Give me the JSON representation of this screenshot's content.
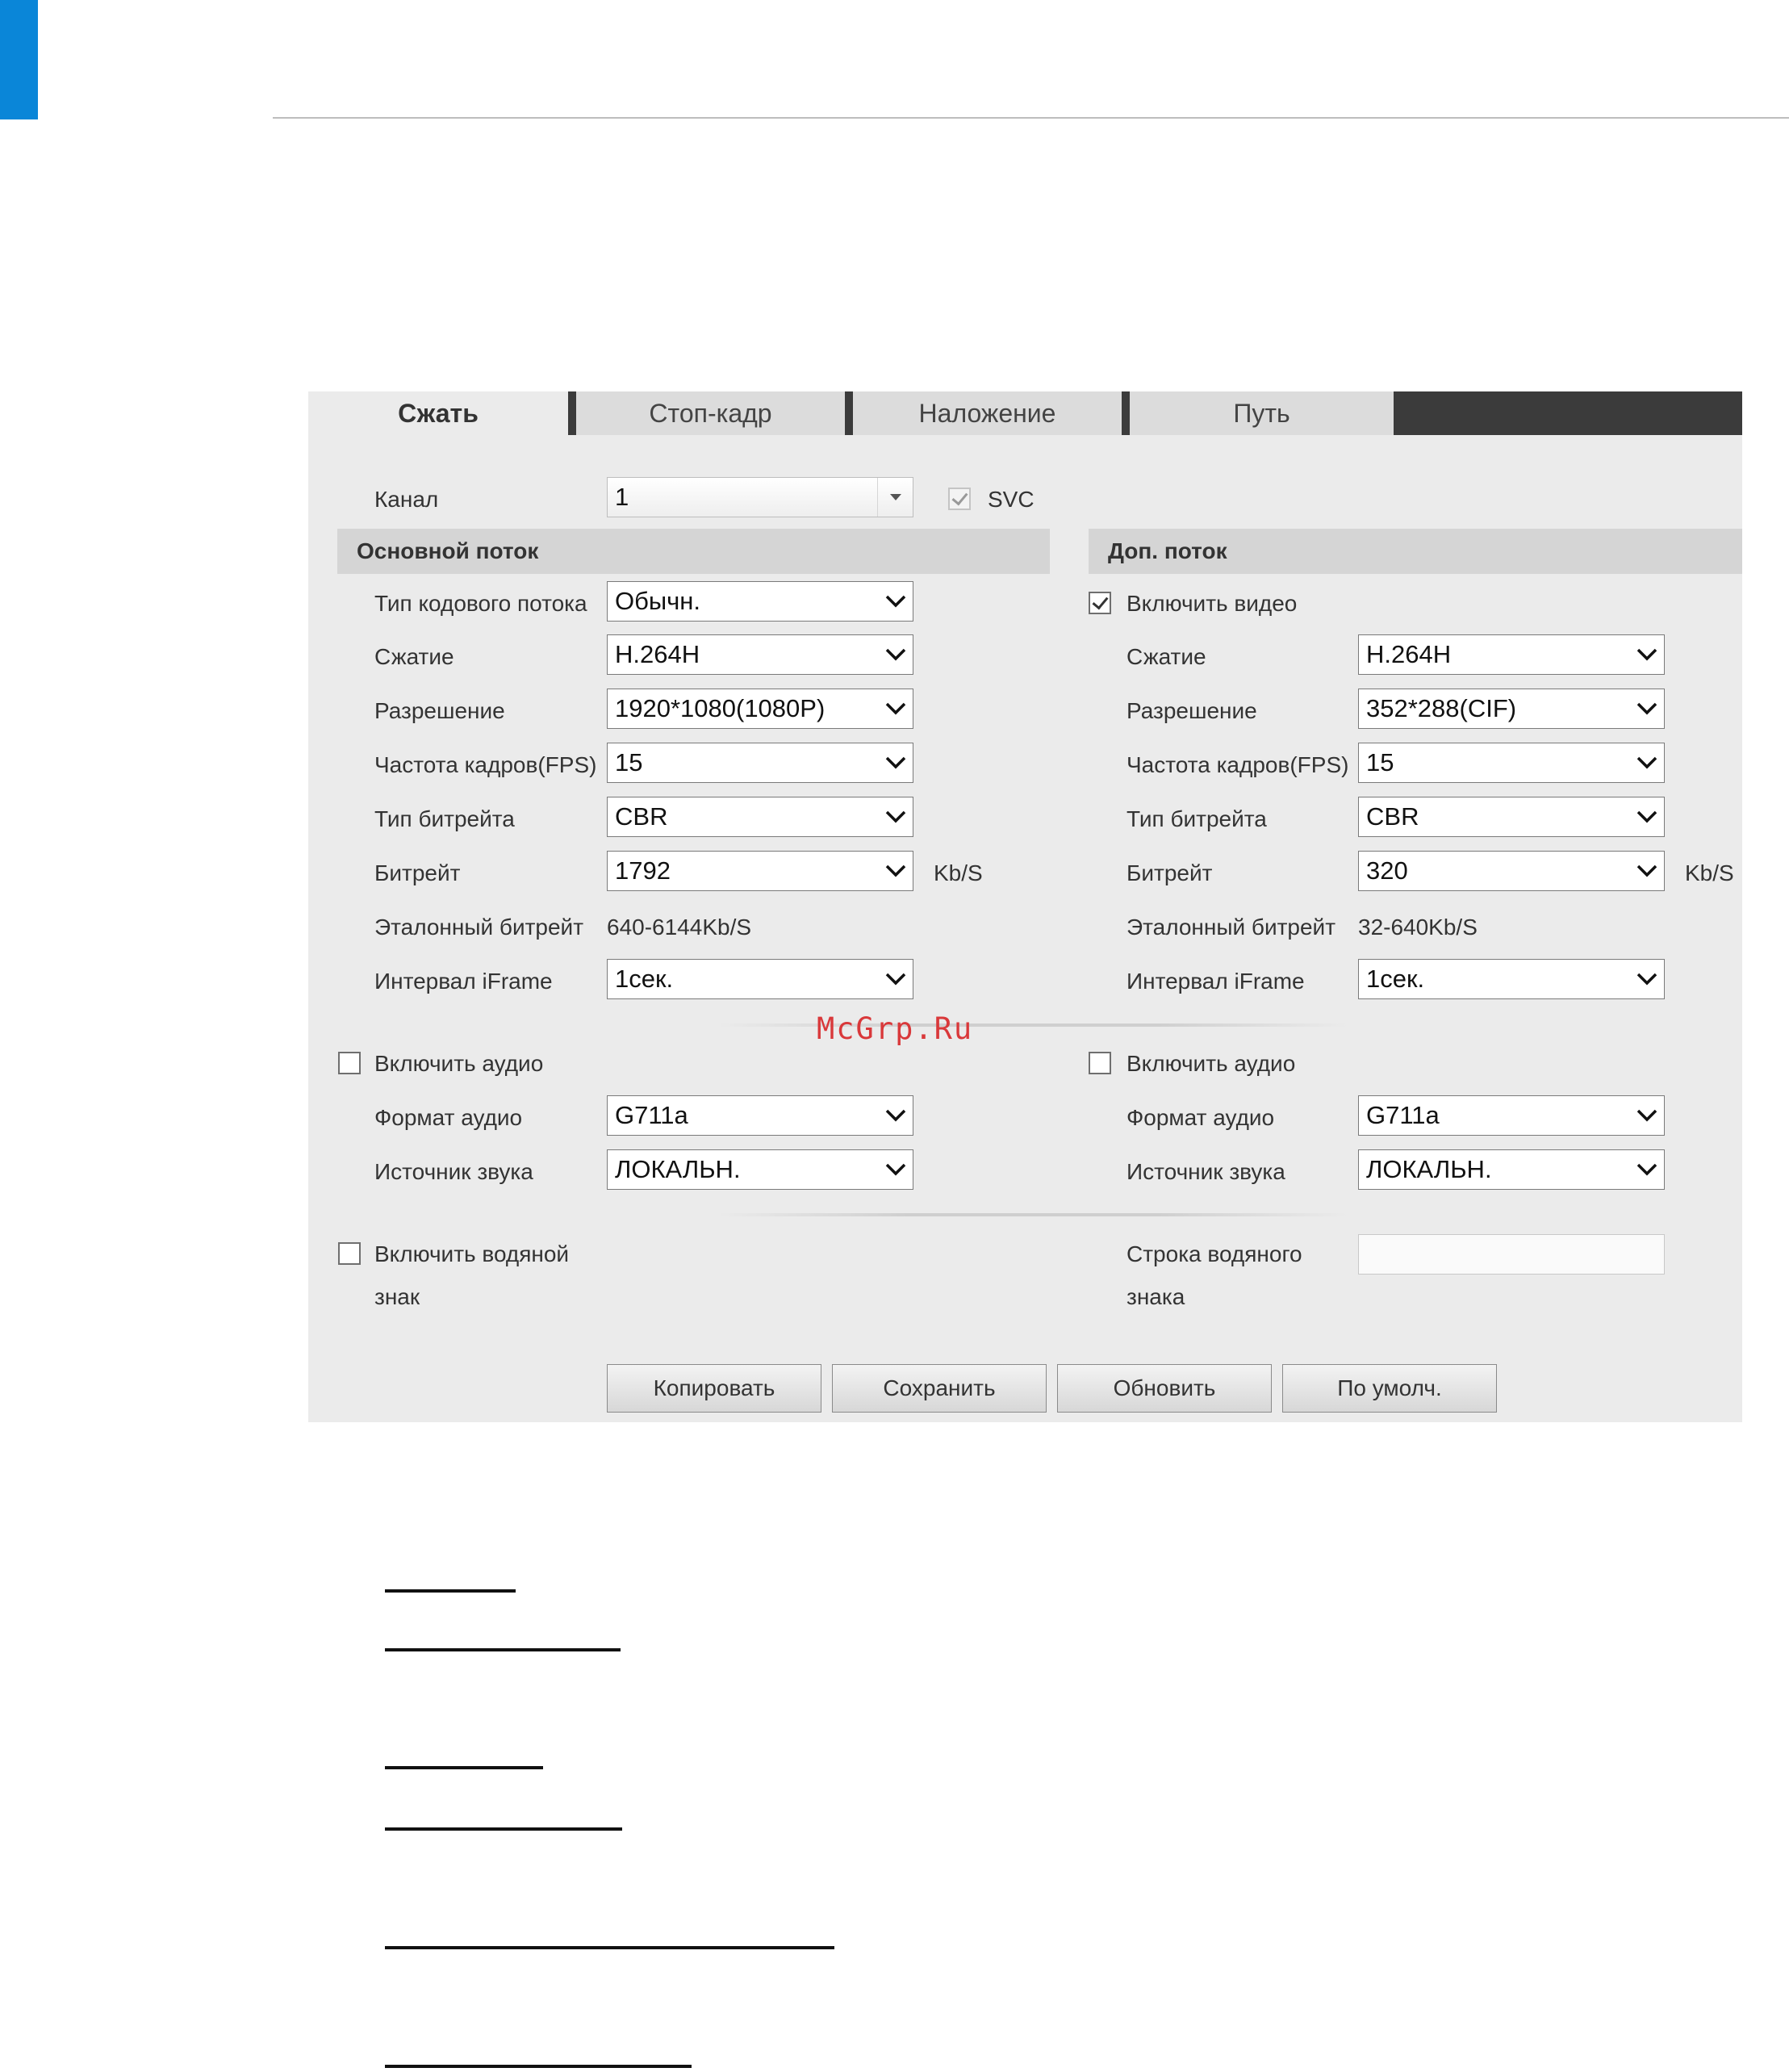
{
  "watermark": "McGrp.Ru",
  "tabs": [
    {
      "label": "Сжать"
    },
    {
      "label": "Стоп-кадр"
    },
    {
      "label": "Наложение"
    },
    {
      "label": "Путь"
    }
  ],
  "channel": {
    "label": "Канал",
    "value": "1",
    "svc_label": "SVC"
  },
  "main_stream": {
    "header": "Основной поток",
    "stream_type_label": "Тип кодового потока",
    "stream_type_value": "Обычн.",
    "compression_label": "Сжатие",
    "compression_value": "H.264H",
    "resolution_label": "Разрешение",
    "resolution_value": "1920*1080(1080P)",
    "fps_label": "Частота кадров(FPS)",
    "fps_value": "15",
    "bitrate_type_label": "Тип битрейта",
    "bitrate_type_value": "CBR",
    "bitrate_label": "Битрейт",
    "bitrate_value": "1792",
    "bitrate_unit": "Kb/S",
    "ref_bitrate_label": "Эталонный битрейт",
    "ref_bitrate_value": "640-6144Kb/S",
    "iframe_label": "Интервал iFrame",
    "iframe_value": "1сек.",
    "audio_enable_label": "Включить аудио",
    "audio_format_label": "Формат аудио",
    "audio_format_value": "G711a",
    "audio_source_label": "Источник звука",
    "audio_source_value": "ЛОКАЛЬН.",
    "watermark_enable_label_1": "Включить водяной",
    "watermark_enable_label_2": "знак"
  },
  "sub_stream": {
    "header": "Доп. поток",
    "video_enable_label": "Включить видео",
    "compression_label": "Сжатие",
    "compression_value": "H.264H",
    "resolution_label": "Разрешение",
    "resolution_value": "352*288(CIF)",
    "fps_label": "Частота кадров(FPS)",
    "fps_value": "15",
    "bitrate_type_label": "Тип битрейта",
    "bitrate_type_value": "CBR",
    "bitrate_label": "Битрейт",
    "bitrate_value": "320",
    "bitrate_unit": "Kb/S",
    "ref_bitrate_label": "Эталонный битрейт",
    "ref_bitrate_value": "32-640Kb/S",
    "iframe_label": "Интервал iFrame",
    "iframe_value": "1сек.",
    "audio_enable_label": "Включить аудио",
    "audio_format_label": "Формат аудио",
    "audio_format_value": "G711a",
    "audio_source_label": "Источник звука",
    "audio_source_value": "ЛОКАЛЬН.",
    "watermark_string_label_1": "Строка водяного",
    "watermark_string_label_2": "знака",
    "watermark_string_value": ""
  },
  "buttons": {
    "copy": "Копировать",
    "save": "Сохранить",
    "refresh": "Обновить",
    "default": "По умолч."
  },
  "colors": {
    "accent_blue": "#0a86d8",
    "panel_bg": "#ebebeb",
    "tab_bar": "#3b3b3b",
    "watermark_red": "#d9383a"
  }
}
